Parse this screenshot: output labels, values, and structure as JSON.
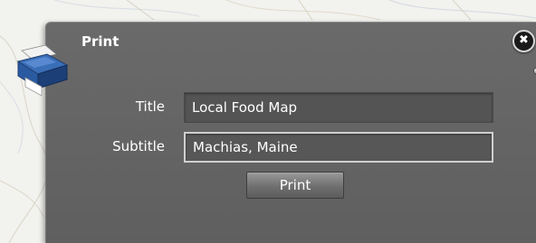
{
  "dialog": {
    "title": "Print",
    "icon": "printer-icon",
    "minimize_icon": "minimize-icon",
    "close_icon": "close-icon",
    "close_glyph": "✖"
  },
  "form": {
    "title_label": "Title",
    "title_value": "Local Food Map",
    "subtitle_label": "Subtitle",
    "subtitle_value": "Machias, Maine",
    "print_button_label": "Print"
  },
  "colors": {
    "dialog_bg": "#636363",
    "field_bg": "#545454",
    "focused_border": "#cfcfcf",
    "text": "#ffffff"
  }
}
